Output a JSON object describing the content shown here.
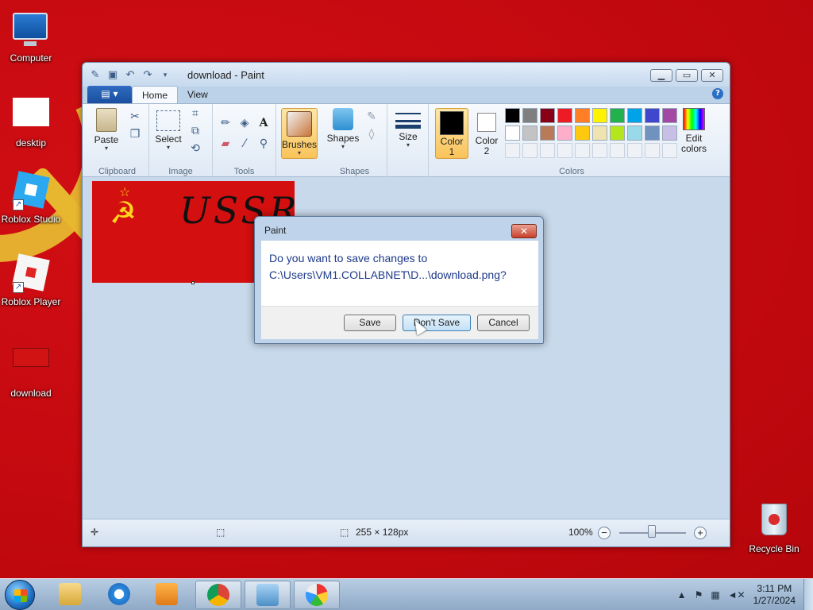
{
  "desktop": {
    "icons": [
      {
        "label": "Computer"
      },
      {
        "label": "desktip"
      },
      {
        "label": "Roblox Studio"
      },
      {
        "label": "Roblox Player"
      },
      {
        "label": "download"
      },
      {
        "label": "Recycle Bin"
      }
    ]
  },
  "window": {
    "title": "download - Paint",
    "tabs": {
      "home": "Home",
      "view": "View"
    },
    "ribbon": {
      "paste": "Paste",
      "select": "Select",
      "brushes": "Brushes",
      "shapes": "Shapes",
      "size": "Size",
      "color1": "Color\n1",
      "color1_a": "Color",
      "color1_b": "1",
      "color2_a": "Color",
      "color2_b": "2",
      "edit_colors_a": "Edit",
      "edit_colors_b": "colors",
      "groups": {
        "clipboard": "Clipboard",
        "image": "Image",
        "tools": "Tools",
        "shapes": "Shapes",
        "colors": "Colors"
      }
    },
    "palette_row1": [
      "#000000",
      "#7f7f7f",
      "#880015",
      "#ed1c24",
      "#ff7f27",
      "#fff200",
      "#22b14c",
      "#00a2e8",
      "#3f48cc",
      "#a349a4"
    ],
    "palette_row2": [
      "#ffffff",
      "#c3c3c3",
      "#b97a57",
      "#ffaec9",
      "#ffc90e",
      "#efe4b0",
      "#b5e61d",
      "#99d9ea",
      "#7092be",
      "#c8bfe7"
    ],
    "canvas_text": "USSR",
    "status": {
      "size": "255 × 128px",
      "zoom": "100%"
    }
  },
  "dialog": {
    "title": "Paint",
    "message_line1": "Do you want to save changes to",
    "message_line2": "C:\\Users\\VM1.COLLABNET\\D...\\download.png?",
    "save": "Save",
    "dont_save": "Don't Save",
    "cancel": "Cancel"
  },
  "taskbar": {
    "time": "3:11 PM",
    "date": "1/27/2024"
  }
}
